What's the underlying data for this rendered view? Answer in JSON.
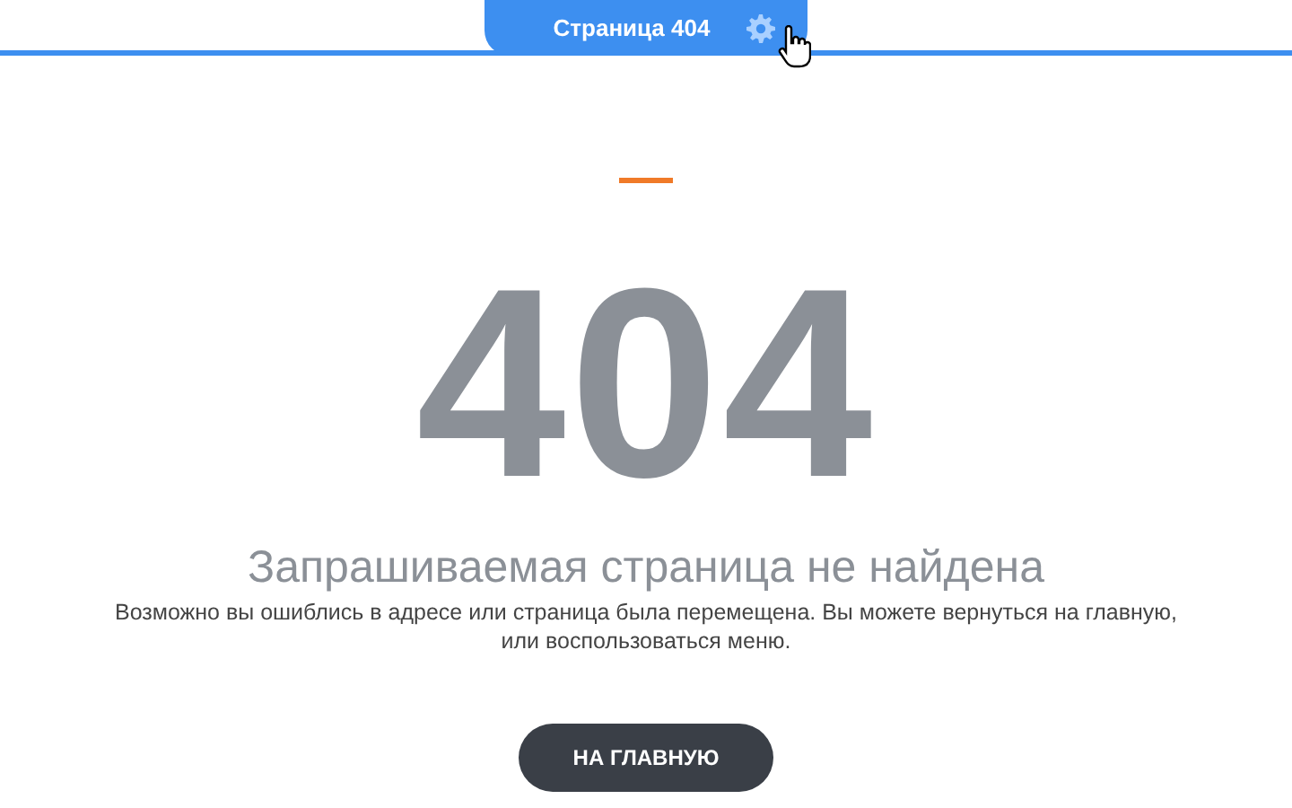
{
  "page_tab": {
    "title": "Страница 404"
  },
  "error_code": "404",
  "heading": "Запрашиваемая страница не найдена",
  "message": "Возможно вы ошиблись в адресе или страница была перемещена. Вы можете вернуться на главную, или воспользоваться меню.",
  "button": "НА ГЛАВНУЮ"
}
